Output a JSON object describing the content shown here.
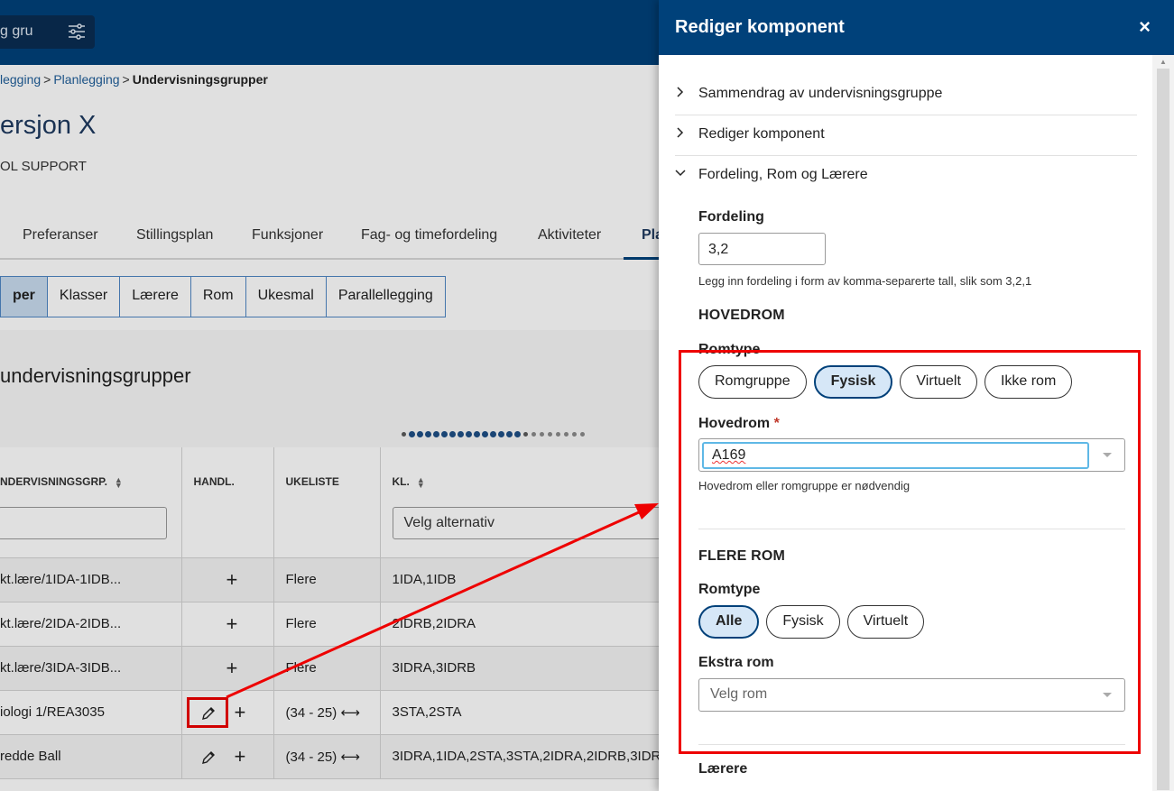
{
  "topbar": {
    "search_text": "g gru",
    "filter_icon": "sliders-icon"
  },
  "breadcrumb": {
    "item1": "legging",
    "item2": "Planlegging",
    "current": "Undervisningsgrupper",
    "separator": ">"
  },
  "page": {
    "title": "ersjon X",
    "subtitle": "OL SUPPORT",
    "section_title": "undervisningsgrupper"
  },
  "main_tabs": [
    "Preferanser",
    "Stillingsplan",
    "Funksjoner",
    "Fag- og timefordeling",
    "Aktiviteter",
    "Pla"
  ],
  "sub_tabs": [
    "per",
    "Klasser",
    "Lærere",
    "Rom",
    "Ukesmal",
    "Parallellegging"
  ],
  "table": {
    "headers": {
      "group": "NDERVISNINGSGRP.",
      "actions": "HANDL.",
      "week": "UKELISTE",
      "class": "KL."
    },
    "class_filter_placeholder": "Velg alternativ",
    "rows": [
      {
        "group": "kt.lære/1IDA-1IDB...",
        "week": "Flere",
        "classes": "1IDA,1IDB",
        "is_link": false,
        "has_edit": false
      },
      {
        "group": "kt.lære/2IDA-2IDB...",
        "week": "Flere",
        "classes": "2IDRB,2IDRA",
        "is_link": false,
        "has_edit": false
      },
      {
        "group": "kt.lære/3IDA-3IDB...",
        "week": "Flere",
        "classes": "3IDRA,3IDRB",
        "is_link": false,
        "has_edit": false
      },
      {
        "group": "iologi 1/REA3035",
        "week": "(34 - 25) ⟷",
        "classes": "3STA,2STA",
        "is_link": true,
        "has_edit": true
      },
      {
        "group": "redde Ball",
        "week": "(34 - 25) ⟷",
        "classes": "3IDRA,1IDA,2STA,3STA,2IDRA,2IDRB,3IDR",
        "is_link": true,
        "has_edit": true
      }
    ],
    "plus": "+"
  },
  "drawer": {
    "title": "Rediger komponent",
    "close": "×",
    "accordion": [
      {
        "label": "Sammendrag av undervisningsgruppe",
        "open": false
      },
      {
        "label": "Rediger komponent",
        "open": false
      },
      {
        "label": "Fordeling, Rom og Lærere",
        "open": true
      }
    ],
    "fordeling": {
      "label": "Fordeling",
      "value": "3,2",
      "help": "Legg inn fordeling i form av komma-separerte tall, slik som 3,2,1"
    },
    "hovedrom_section": "HOVEDROM",
    "romtype_label": "Romtype",
    "romtype_options": [
      "Romgruppe",
      "Fysisk",
      "Virtuelt",
      "Ikke rom"
    ],
    "romtype_selected": "Fysisk",
    "hovedrom": {
      "label": "Hovedrom",
      "required_mark": "*",
      "value": "A169",
      "help": "Hovedrom eller romgruppe er nødvendig"
    },
    "flere_rom_section": "FLERE ROM",
    "flere_romtype_label": "Romtype",
    "flere_romtype_options": [
      "Alle",
      "Fysisk",
      "Virtuelt"
    ],
    "flere_romtype_selected": "Alle",
    "ekstra_rom": {
      "label": "Ekstra rom",
      "placeholder": "Velg rom"
    },
    "next_section_partial": "Lærere"
  },
  "colors": {
    "header": "#00417a",
    "highlight": "#e00000",
    "link": "#1f5e99"
  }
}
